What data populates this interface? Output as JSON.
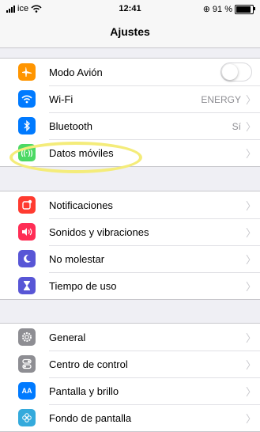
{
  "status_bar": {
    "carrier": "ice",
    "time": "12:41",
    "battery_text": "91 %",
    "battery_level": 0.91
  },
  "nav": {
    "title": "Ajustes"
  },
  "groups": [
    {
      "rows": [
        {
          "label": "Modo Avión",
          "icon": "airplane-icon",
          "color": "#ff9500",
          "control": "toggle",
          "toggle_on": false
        },
        {
          "label": "Wi-Fi",
          "icon": "wifi-icon",
          "color": "#007aff",
          "value": "ENERGY"
        },
        {
          "label": "Bluetooth",
          "icon": "bluetooth-icon",
          "color": "#007aff",
          "value": "Sí"
        },
        {
          "label": "Datos móviles",
          "icon": "antenna-icon",
          "color": "#4cd964",
          "value": ""
        }
      ]
    },
    {
      "rows": [
        {
          "label": "Notificaciones",
          "icon": "notifications-icon",
          "color": "#ff3b30"
        },
        {
          "label": "Sonidos y vibraciones",
          "icon": "speaker-icon",
          "color": "#ff2d55"
        },
        {
          "label": "No molestar",
          "icon": "moon-icon",
          "color": "#5856d6"
        },
        {
          "label": "Tiempo de uso",
          "icon": "hourglass-icon",
          "color": "#5856d6"
        }
      ]
    },
    {
      "rows": [
        {
          "label": "General",
          "icon": "gear-icon",
          "color": "#8e8e93"
        },
        {
          "label": "Centro de control",
          "icon": "switches-icon",
          "color": "#8e8e93"
        },
        {
          "label": "Pantalla y brillo",
          "icon": "text-size-icon",
          "color": "#007aff"
        },
        {
          "label": "Fondo de pantalla",
          "icon": "flower-icon",
          "color": "#34aadc"
        }
      ]
    }
  ]
}
